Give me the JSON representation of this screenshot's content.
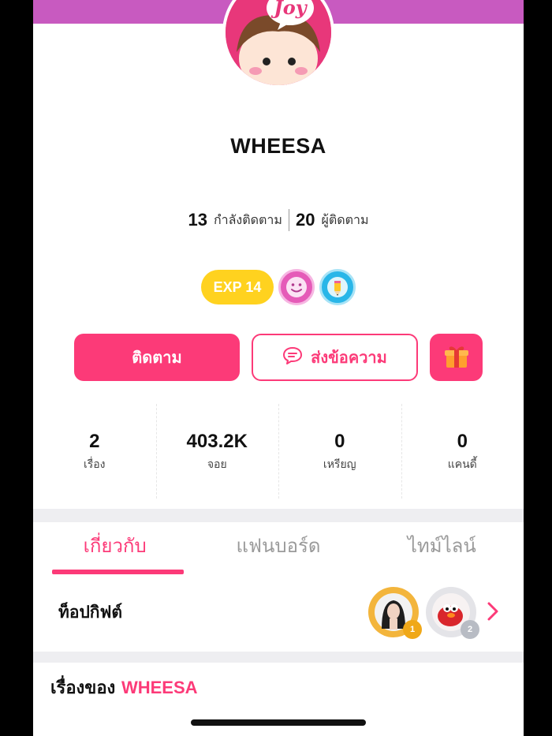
{
  "profile": {
    "avatar_text": "Joy",
    "name": "WHEESA"
  },
  "social": {
    "following_count": "13",
    "following_label": "กำลังติดตาม",
    "followers_count": "20",
    "followers_label": "ผู้ติดตาม"
  },
  "badges": {
    "exp_label": "EXP 14",
    "items": [
      {
        "icon": "smiley-face-icon",
        "color": "#e55bb8"
      },
      {
        "icon": "pencil-icon",
        "color": "#29b6e8"
      }
    ]
  },
  "actions": {
    "follow_label": "ติดตาม",
    "message_label": "ส่งข้อความ",
    "message_icon": "chat-bubble-icon",
    "gift_icon": "gift-box-icon"
  },
  "counts": [
    {
      "value": "2",
      "label": "เรื่อง"
    },
    {
      "value": "403.2K",
      "label": "จอย"
    },
    {
      "value": "0",
      "label": "เหรียญ"
    },
    {
      "value": "0",
      "label": "แคนดี้"
    }
  ],
  "tabs": [
    {
      "label": "เกี่ยวกับ",
      "active": true
    },
    {
      "label": "แฟนบอร์ด",
      "active": false
    },
    {
      "label": "ไทม์ไลน์",
      "active": false
    }
  ],
  "top_gift": {
    "title": "ท็อปกิฟต์",
    "gifters": [
      {
        "rank": "1",
        "avatar": "girl-photo-avatar",
        "frame_color": "#f3b53c"
      },
      {
        "rank": "2",
        "avatar": "red-plush-avatar",
        "frame_color": "#d9d9de"
      }
    ],
    "chevron_icon": "chevron-right-icon"
  },
  "stories": {
    "title_prefix": "เรื่องของ",
    "title_name": "WHEESA"
  },
  "colors": {
    "accent": "#fc3a78",
    "header_band": "#c85ac0",
    "exp_yellow": "#ffd21f"
  }
}
